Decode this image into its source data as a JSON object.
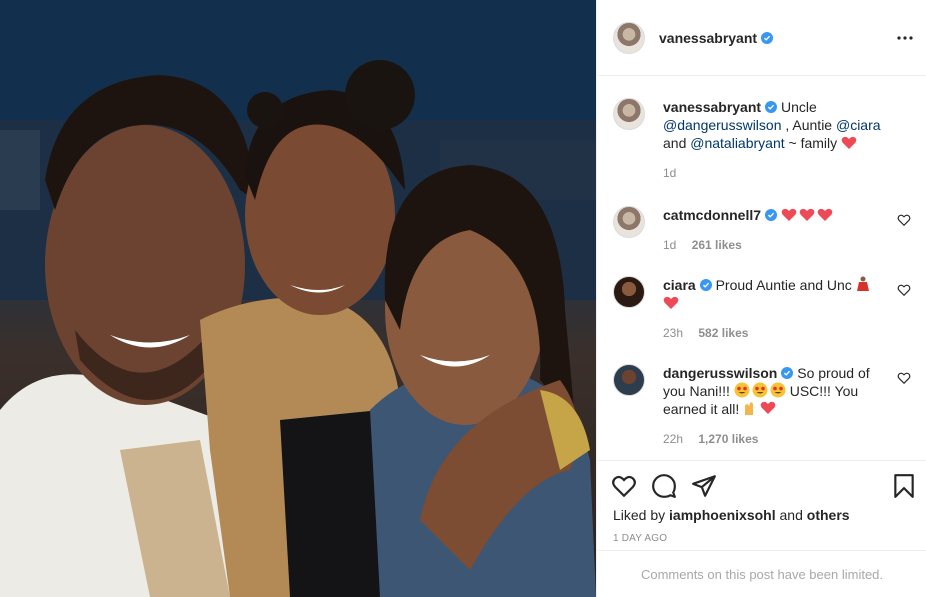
{
  "header": {
    "username": "vanessabryant"
  },
  "caption": {
    "username": "vanessabryant",
    "text_1": "Uncle",
    "mention_1": "@dangerusswilson",
    "text_2": ", Auntie",
    "mention_2": "@ciara",
    "text_3": "and",
    "mention_3": "@nataliabryant",
    "text_4": "~ family",
    "time": "1d"
  },
  "comments": [
    {
      "username": "catmcdonnell7",
      "time": "1d",
      "likes": "261 likes"
    },
    {
      "username": "ciara",
      "text": "Proud Auntie and Unc",
      "time": "23h",
      "likes": "582 likes"
    },
    {
      "username": "dangerusswilson",
      "text_1": "So proud of you Nani!!!",
      "text_2": "USC!!! You earned it all!",
      "time": "22h",
      "likes": "1,270 likes"
    }
  ],
  "liked_by": {
    "prefix": "Liked by",
    "user": "iamphoenixsohl",
    "joiner": "and",
    "others": "others"
  },
  "post_age": "1 DAY AGO",
  "limited_notice": "Comments on this post have been limited.",
  "colors": {
    "verified": "#3897f0",
    "heart_red": "#ed4956",
    "mention": "#00376b",
    "muted": "#8e8e8e"
  }
}
